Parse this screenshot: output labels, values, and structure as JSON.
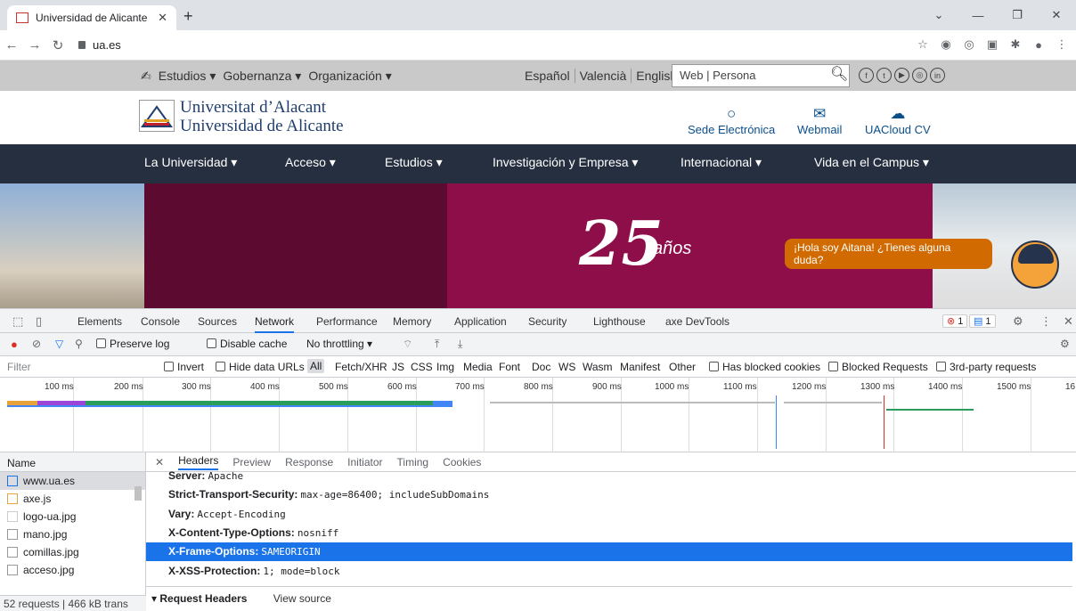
{
  "browser": {
    "tab_title": "Universidad de Alicante",
    "url": "ua.es"
  },
  "site": {
    "topnav": [
      "Estudios ▾",
      "Gobernanza ▾",
      "Organización ▾"
    ],
    "languages": [
      "Español",
      "Valencià",
      "English"
    ],
    "search_placeholder": "Web | Persona",
    "logo_line1": "Universitat d’Alacant",
    "logo_line2": "Universidad de Alicante",
    "quick_links": [
      "Sede Electrónica",
      "Webmail",
      "UACloud CV"
    ],
    "mainnav": [
      "La Universidad ▾",
      "Acceso ▾",
      "Estudios ▾",
      "Investigación y Empresa ▾",
      "Internacional ▾",
      "Vida en el Campus ▾"
    ],
    "hero_number": "25",
    "hero_anos": "años",
    "chat_bubble": "¡Hola soy Aitana! ¿Tienes alguna duda?"
  },
  "devtools": {
    "tabs": [
      "Elements",
      "Console",
      "Sources",
      "Network",
      "Performance",
      "Memory",
      "Application",
      "Security",
      "Lighthouse",
      "axe DevTools"
    ],
    "error_count": "1",
    "message_count": "1",
    "toolbar": {
      "preserve_log": "Preserve log",
      "disable_cache": "Disable cache",
      "throttling": "No throttling"
    },
    "filter": {
      "placeholder": "Filter",
      "invert": "Invert",
      "hide_data_urls": "Hide data URLs",
      "types": [
        "All",
        "Fetch/XHR",
        "JS",
        "CSS",
        "Img",
        "Media",
        "Font",
        "Doc",
        "WS",
        "Wasm",
        "Manifest",
        "Other"
      ],
      "has_blocked_cookies": "Has blocked cookies",
      "blocked_requests": "Blocked Requests",
      "third_party": "3rd-party requests"
    },
    "timeline_ticks": [
      "100 ms",
      "200 ms",
      "300 ms",
      "400 ms",
      "500 ms",
      "600 ms",
      "700 ms",
      "800 ms",
      "900 ms",
      "1000 ms",
      "1100 ms",
      "1200 ms",
      "1300 ms",
      "1400 ms",
      "1500 ms",
      "16"
    ],
    "name_header": "Name",
    "requests": [
      "www.ua.es",
      "axe.js",
      "logo-ua.jpg",
      "mano.jpg",
      "comillas.jpg",
      "acceso.jpg"
    ],
    "status": "52 requests | 466 kB trans",
    "detail_tabs": [
      "Headers",
      "Preview",
      "Response",
      "Initiator",
      "Timing",
      "Cookies"
    ],
    "headers": [
      {
        "name": "Server:",
        "value": "Apache"
      },
      {
        "name": "Strict-Transport-Security:",
        "value": "max-age=86400; includeSubDomains"
      },
      {
        "name": "Vary:",
        "value": "Accept-Encoding"
      },
      {
        "name": "X-Content-Type-Options:",
        "value": "nosniff"
      },
      {
        "name": "X-Frame-Options:",
        "value": "SAMEORIGIN"
      },
      {
        "name": "X-XSS-Protection:",
        "value": "1; mode=block"
      }
    ],
    "request_headers": "▾ Request Headers",
    "view_source": "View source"
  }
}
